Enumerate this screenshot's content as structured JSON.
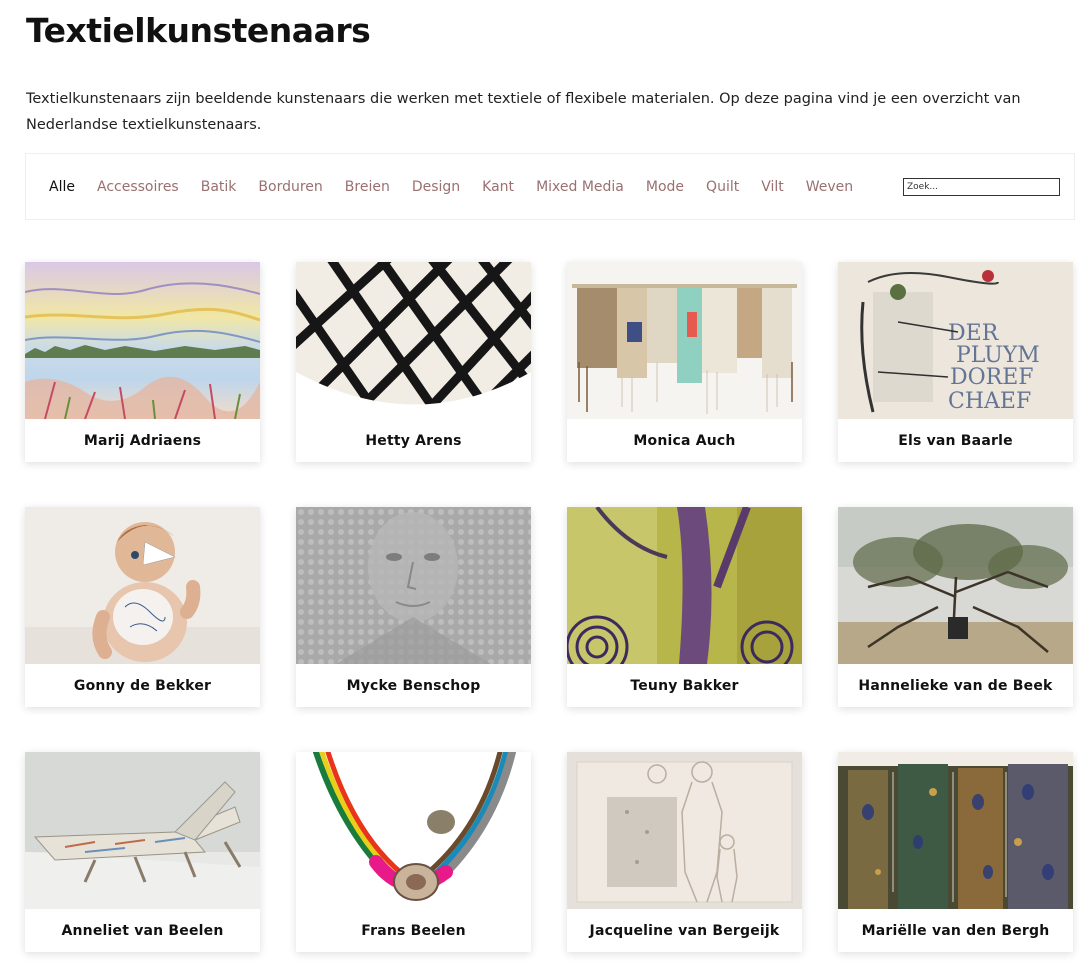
{
  "page": {
    "title": "Textielkunstenaars",
    "intro": "Textielkunstenaars zijn beeldende kunstenaars die werken met textiele of flexibele materialen. Op deze pagina vind je een overzicht van Nederlandse textielkunstenaars."
  },
  "filters": {
    "items": [
      "Alle",
      "Accessoires",
      "Batik",
      "Borduren",
      "Breien",
      "Design",
      "Kant",
      "Mixed Media",
      "Mode",
      "Quilt",
      "Vilt",
      "Weven"
    ],
    "active": "Alle",
    "search_placeholder": "Zoek..."
  },
  "artists": [
    {
      "name": "Marij Adriaens"
    },
    {
      "name": "Hetty Arens"
    },
    {
      "name": "Monica Auch"
    },
    {
      "name": "Els van Baarle"
    },
    {
      "name": "Gonny de Bekker"
    },
    {
      "name": "Mycke Benschop"
    },
    {
      "name": "Teuny Bakker"
    },
    {
      "name": "Hannelieke van de Beek"
    },
    {
      "name": "Anneliet van Beelen"
    },
    {
      "name": "Frans Beelen"
    },
    {
      "name": "Jacqueline van Bergeijk"
    },
    {
      "name": "Mariëlle van den Bergh"
    }
  ],
  "colors": {
    "filter_inactive": "#9a7070",
    "filter_active": "#111111"
  }
}
